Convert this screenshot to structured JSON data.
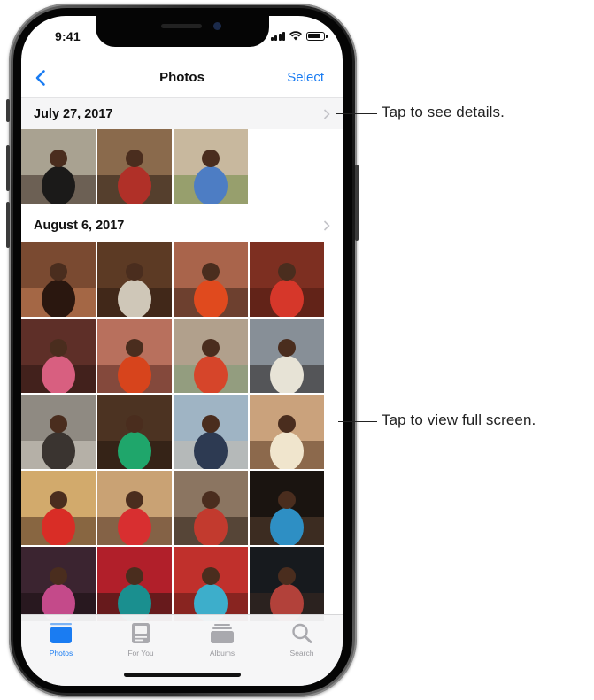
{
  "status_bar": {
    "time": "9:41"
  },
  "nav": {
    "back_icon": "chevron-left-icon",
    "title": "Photos",
    "select_label": "Select"
  },
  "sections": [
    {
      "date": "July 27, 2017"
    },
    {
      "date": "August 6, 2017"
    }
  ],
  "tabs": [
    {
      "label": "Photos",
      "icon": "photos-tab-icon",
      "active": true
    },
    {
      "label": "For You",
      "icon": "for-you-tab-icon",
      "active": false
    },
    {
      "label": "Albums",
      "icon": "albums-tab-icon",
      "active": false
    },
    {
      "label": "Search",
      "icon": "search-tab-icon",
      "active": false
    }
  ],
  "callouts": {
    "details": "Tap to see details.",
    "full_screen": "Tap to view full screen."
  },
  "colors": {
    "accent": "#1a7cf2",
    "tab_inactive": "#9a9a9f"
  },
  "photos": {
    "july": [
      {
        "bg": "#a9a291",
        "fig": "#1b1a19",
        "accent": "#3b2a22"
      },
      {
        "bg": "#8a6a4c",
        "fig": "#b03028",
        "accent": "#2a1c14"
      },
      {
        "bg": "#c8b89e",
        "fig": "#4d7dc4",
        "accent": "#6f8b46"
      }
    ],
    "august": [
      {
        "bg": "#7a4a31",
        "fig": "#2a170f",
        "accent": "#c77f55"
      },
      {
        "bg": "#5c3a24",
        "fig": "#cfc7b8",
        "accent": "#2c1a10"
      },
      {
        "bg": "#a9644b",
        "fig": "#e04a1e",
        "accent": "#3d231a"
      },
      {
        "bg": "#7d2f21",
        "fig": "#d6372a",
        "accent": "#4d1a12"
      },
      {
        "bg": "#5e2f28",
        "fig": "#d85f80",
        "accent": "#2b1512"
      },
      {
        "bg": "#b8705d",
        "fig": "#d7441c",
        "accent": "#5a2a20"
      },
      {
        "bg": "#b1a08c",
        "fig": "#d6452a",
        "accent": "#7a9b74"
      },
      {
        "bg": "#878f97",
        "fig": "#e7e3d6",
        "accent": "#2a2624"
      },
      {
        "bg": "#8f8a82",
        "fig": "#3a3430",
        "accent": "#d5cfc6"
      },
      {
        "bg": "#4c3322",
        "fig": "#1fa66b",
        "accent": "#22150e"
      },
      {
        "bg": "#9fb4c4",
        "fig": "#2d3a52",
        "accent": "#c6bdb0"
      },
      {
        "bg": "#caa27c",
        "fig": "#f0e5cd",
        "accent": "#5a3a25"
      },
      {
        "bg": "#d2aa6c",
        "fig": "#d92d26",
        "accent": "#4a2e1f"
      },
      {
        "bg": "#c9a274",
        "fig": "#d82f30",
        "accent": "#4a2e20"
      },
      {
        "bg": "#8b7561",
        "fig": "#c23a2e",
        "accent": "#2b1d15"
      },
      {
        "bg": "#1a1410",
        "fig": "#2e8fc4",
        "accent": "#5a4030"
      },
      {
        "bg": "#3b2430",
        "fig": "#c44a8a",
        "accent": "#1a0f12"
      },
      {
        "bg": "#b11f2a",
        "fig": "#1a8f8f",
        "accent": "#2a1510"
      },
      {
        "bg": "#c0302c",
        "fig": "#3daecb",
        "accent": "#5a1c18"
      },
      {
        "bg": "#171a1e",
        "fig": "#b2413a",
        "accent": "#3c2a20"
      }
    ]
  }
}
